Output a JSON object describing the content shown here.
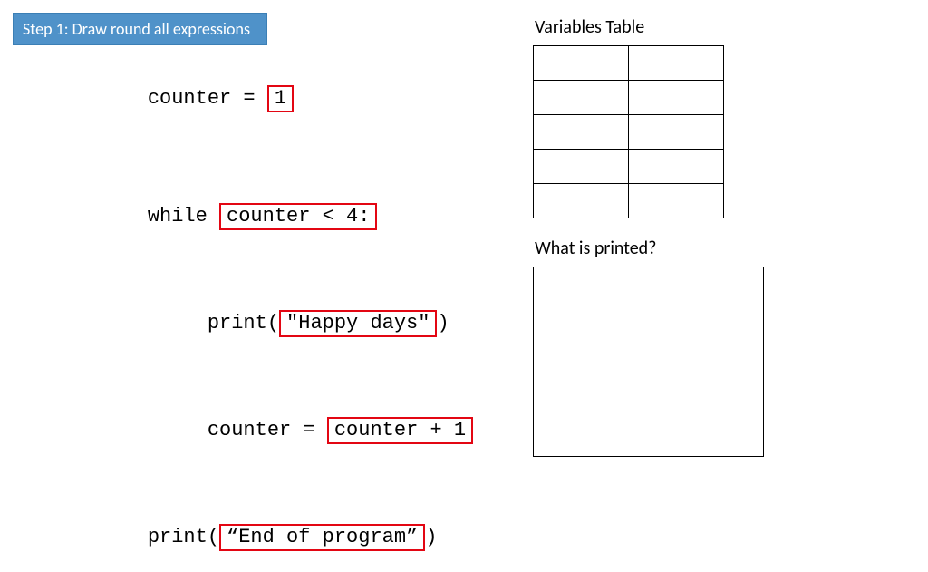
{
  "banner": {
    "title": "Step 1: Draw round all expressions"
  },
  "code": {
    "l1_a": "counter = ",
    "l1_b": "1",
    "l2_a": "while ",
    "l2_b": "counter < 4:",
    "l3_a": "     print(",
    "l3_b": "\"Happy days\"",
    "l3_c": ")",
    "l4_a": "     counter = ",
    "l4_b": "counter + 1",
    "l5_a": "print(",
    "l5_b": "“End of program”",
    "l5_c": ")"
  },
  "right": {
    "vars_heading": "Variables Table",
    "printed_heading": "What is printed?",
    "vars_rows": 5,
    "vars_cols": 2
  }
}
